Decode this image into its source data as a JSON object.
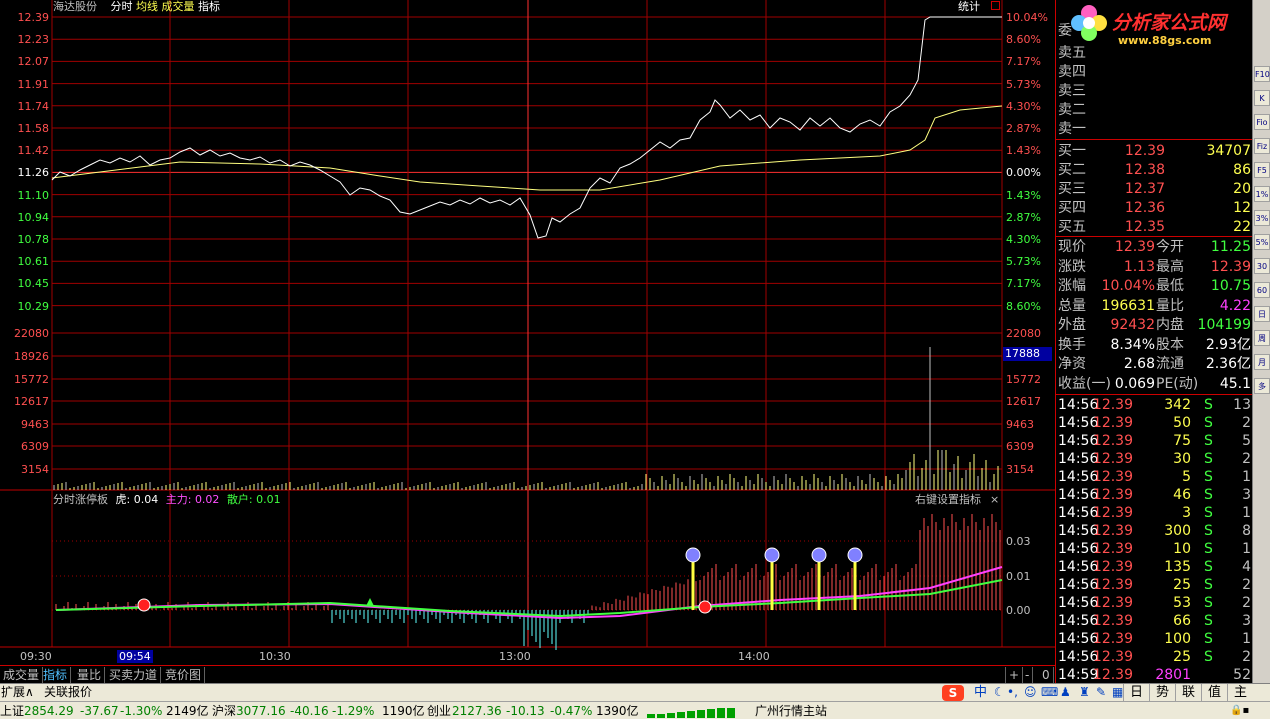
{
  "header": {
    "stock_name": "海达股份",
    "mode_tabs": [
      "分时",
      "均线",
      "成交量",
      "指标"
    ],
    "stats_label": "统计"
  },
  "price_axis": {
    "left": [
      "12.39",
      "12.23",
      "12.07",
      "11.91",
      "11.74",
      "11.58",
      "11.42",
      "11.26",
      "11.10",
      "10.94",
      "10.78",
      "10.61",
      "10.45",
      "10.29"
    ],
    "right": [
      "10.04%",
      "8.60%",
      "7.17%",
      "5.73%",
      "4.30%",
      "2.87%",
      "1.43%",
      "0.00%",
      "1.43%",
      "2.87%",
      "4.30%",
      "5.73%",
      "7.17%",
      "8.60%"
    ]
  },
  "volume_axis": {
    "labels": [
      "22080",
      "18926",
      "15772",
      "12617",
      "9463",
      "6309",
      "3154"
    ],
    "current_volume": "17888"
  },
  "indicator": {
    "name": "分时涨停板",
    "hu_label": "虎:",
    "hu_value": "0.04",
    "zhuli_label": "主力:",
    "zhuli_value": "0.02",
    "sanhu_label": "散户:",
    "sanhu_value": "0.01",
    "settings_label": "右键设置指标",
    "close_symbol": "×",
    "axis": [
      "0.03",
      "0.01",
      "0.00"
    ]
  },
  "time_axis": {
    "labels": [
      "09:30",
      "09:54",
      "10:30",
      "13:00",
      "14:00"
    ]
  },
  "bottom_tabs": [
    "成交量",
    "指标",
    "量比",
    "买卖力道",
    "竞价图"
  ],
  "scroll_controls": [
    "+",
    "-",
    "0"
  ],
  "logo": {
    "title": "分析家公式网",
    "url": "www.88gs.com"
  },
  "order_book": {
    "wei_label": "委",
    "sell": [
      {
        "label": "卖五",
        "price": "",
        "vol": ""
      },
      {
        "label": "卖四",
        "price": "",
        "vol": ""
      },
      {
        "label": "卖三",
        "price": "",
        "vol": ""
      },
      {
        "label": "卖二",
        "price": "",
        "vol": ""
      },
      {
        "label": "卖一",
        "price": "",
        "vol": ""
      }
    ],
    "buy": [
      {
        "label": "买一",
        "price": "12.39",
        "vol": "34707"
      },
      {
        "label": "买二",
        "price": "12.38",
        "vol": "86"
      },
      {
        "label": "买三",
        "price": "12.37",
        "vol": "20"
      },
      {
        "label": "买四",
        "price": "12.36",
        "vol": "12"
      },
      {
        "label": "买五",
        "price": "12.35",
        "vol": "22"
      }
    ]
  },
  "quote": {
    "rows": [
      {
        "l1": "现价",
        "v1": "12.39",
        "l2": "今开",
        "v2": "11.25"
      },
      {
        "l1": "涨跌",
        "v1": "1.13",
        "l2": "最高",
        "v2": "12.39"
      },
      {
        "l1": "涨幅",
        "v1": "10.04%",
        "l2": "最低",
        "v2": "10.75"
      },
      {
        "l1": "总量",
        "v1": "196631",
        "l2": "量比",
        "v2": "4.22"
      },
      {
        "l1": "外盘",
        "v1": "92432",
        "l2": "内盘",
        "v2": "104199"
      },
      {
        "l1": "换手",
        "v1": "8.34%",
        "l2": "股本",
        "v2": "2.93亿"
      },
      {
        "l1": "净资",
        "v1": "2.68",
        "l2": "流通",
        "v2": "2.36亿"
      },
      {
        "l1": "收益(一)",
        "v1": "0.069",
        "l2": "PE(动)",
        "v2": "45.1"
      }
    ]
  },
  "ticks": [
    {
      "time": "14:56",
      "price": "12.39",
      "vol": "342",
      "bs": "S",
      "n": "13"
    },
    {
      "time": "14:56",
      "price": "12.39",
      "vol": "50",
      "bs": "S",
      "n": "2"
    },
    {
      "time": "14:56",
      "price": "12.39",
      "vol": "75",
      "bs": "S",
      "n": "5"
    },
    {
      "time": "14:56",
      "price": "12.39",
      "vol": "30",
      "bs": "S",
      "n": "2"
    },
    {
      "time": "14:56",
      "price": "12.39",
      "vol": "5",
      "bs": "S",
      "n": "1"
    },
    {
      "time": "14:56",
      "price": "12.39",
      "vol": "46",
      "bs": "S",
      "n": "3"
    },
    {
      "time": "14:56",
      "price": "12.39",
      "vol": "3",
      "bs": "S",
      "n": "1"
    },
    {
      "time": "14:56",
      "price": "12.39",
      "vol": "300",
      "bs": "S",
      "n": "8"
    },
    {
      "time": "14:56",
      "price": "12.39",
      "vol": "10",
      "bs": "S",
      "n": "1"
    },
    {
      "time": "14:56",
      "price": "12.39",
      "vol": "135",
      "bs": "S",
      "n": "4"
    },
    {
      "time": "14:56",
      "price": "12.39",
      "vol": "25",
      "bs": "S",
      "n": "2"
    },
    {
      "time": "14:56",
      "price": "12.39",
      "vol": "53",
      "bs": "S",
      "n": "2"
    },
    {
      "time": "14:56",
      "price": "12.39",
      "vol": "66",
      "bs": "S",
      "n": "3"
    },
    {
      "time": "14:56",
      "price": "12.39",
      "vol": "100",
      "bs": "S",
      "n": "1"
    },
    {
      "time": "14:56",
      "price": "12.39",
      "vol": "25",
      "bs": "S",
      "n": "2"
    },
    {
      "time": "14:59",
      "price": "12.39",
      "vol": "2801",
      "bs": "",
      "n": "52"
    }
  ],
  "ext_row": {
    "expand": "扩展∧",
    "related": "关联报价",
    "right_tabs": [
      "日",
      "势",
      "联",
      "值",
      "主"
    ]
  },
  "ime": {
    "logo": "S",
    "mode": "中"
  },
  "status": {
    "sh_label": "上证",
    "sh_val": "2854.29",
    "sh_chg": "-37.67",
    "sh_pct": "-1.30%",
    "sh_amt": "2149亿",
    "hs_label": "沪深",
    "hs_val": "3077.16",
    "hs_chg": "-40.16",
    "hs_pct": "-1.29%",
    "hs_amt": "1190亿",
    "cy_label": "创业",
    "cy_val": "2127.36",
    "cy_chg": "-10.13",
    "cy_pct": "-0.47%",
    "cy_amt": "1390亿",
    "station": "广州行情主站"
  },
  "side_icons": [
    "F10",
    "K",
    "Fio",
    "Fiz",
    "F5",
    "1%",
    "3%",
    "5%",
    "30",
    "60",
    "日",
    "周",
    "月",
    "多"
  ],
  "colors": {
    "up": "#ff5050",
    "down": "#40ff40",
    "grid": "#a00000",
    "price": "#ffffff",
    "avg": "#ffff80"
  }
}
